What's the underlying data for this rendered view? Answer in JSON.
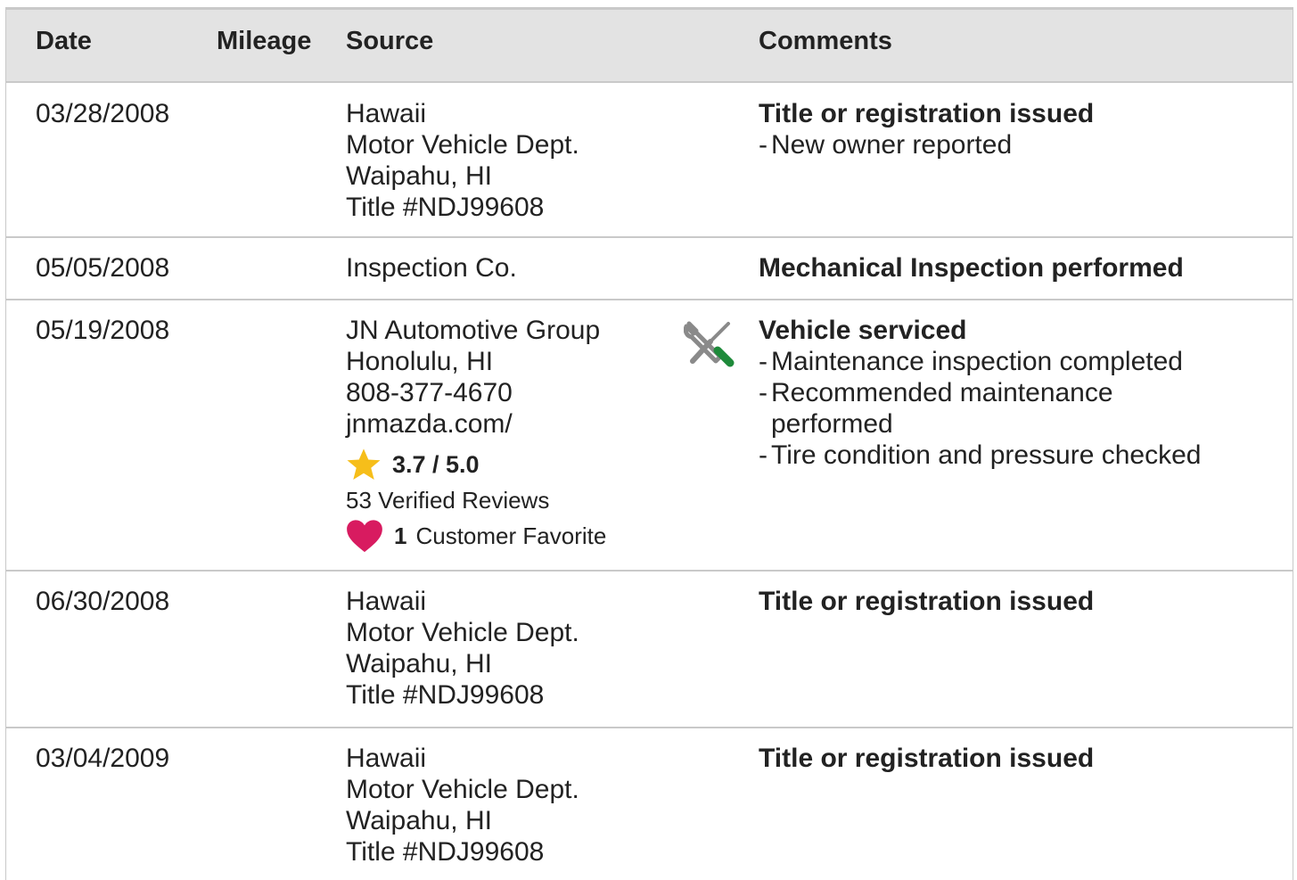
{
  "headers": {
    "date": "Date",
    "mileage": "Mileage",
    "source": "Source",
    "comments": "Comments"
  },
  "rows": [
    {
      "date": "03/28/2008",
      "mileage": "",
      "source": [
        "Hawaii",
        "Motor Vehicle Dept.",
        "Waipahu, HI",
        "Title #NDJ99608"
      ],
      "comment_title": "Title or registration issued",
      "bullets": [
        "New owner reported"
      ]
    },
    {
      "date": "05/05/2008",
      "mileage": "",
      "source": [
        "Inspection Co."
      ],
      "comment_title": "Mechanical Inspection performed",
      "bullets": []
    },
    {
      "date": "05/19/2008",
      "mileage": "",
      "source": [
        "JN Automotive Group",
        "Honolulu, HI",
        "808-377-4670",
        "jnmazda.com/"
      ],
      "rating": "3.7 / 5.0",
      "reviews": "53 Verified Reviews",
      "favorite_count": "1",
      "favorite_label": "Customer Favorite",
      "icon": "wrench-screwdriver-icon",
      "comment_title": "Vehicle serviced",
      "bullets": [
        "Maintenance inspection completed",
        "Recommended maintenance performed",
        "Tire condition and pressure checked"
      ]
    },
    {
      "date": "06/30/2008",
      "mileage": "",
      "source": [
        "Hawaii",
        "Motor Vehicle Dept.",
        "Waipahu, HI",
        "Title #NDJ99608"
      ],
      "comment_title": "Title or registration issued",
      "bullets": []
    },
    {
      "date": "03/04/2009",
      "mileage": "",
      "source": [
        "Hawaii",
        "Motor Vehicle Dept.",
        "Waipahu, HI",
        "Title #NDJ99608"
      ],
      "comment_title": "Title or registration issued",
      "bullets": []
    }
  ],
  "colors": {
    "header_bg": "#e3e3e3",
    "border": "#c9c9c9",
    "star": "#f6be1a",
    "heart": "#d81b60",
    "tool_gray": "#8a8a8a",
    "tool_green": "#1e8a3a"
  }
}
